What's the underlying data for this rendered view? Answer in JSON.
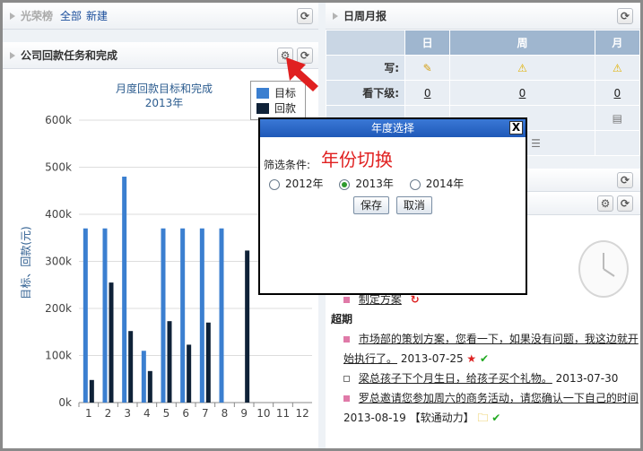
{
  "left_top_panel": {
    "title": "光荣榜",
    "link_all": "全部",
    "link_new": "新建"
  },
  "left_panel": {
    "title": "公司回款任务和完成"
  },
  "chart_data": {
    "type": "bar",
    "title": "月度回款目标和完成",
    "subtitle": "2013年",
    "ylabel": "目标、回款(元)",
    "categories": [
      "1",
      "2",
      "3",
      "4",
      "5",
      "6",
      "7",
      "8",
      "9",
      "10",
      "11",
      "12"
    ],
    "y_ticks": [
      "0k",
      "100k",
      "200k",
      "300k",
      "400k",
      "500k",
      "600k"
    ],
    "ylim": [
      0,
      600000
    ],
    "series": [
      {
        "name": "目标",
        "color": "#3b7fd0",
        "values": [
          370000,
          370000,
          480000,
          110000,
          370000,
          370000,
          370000,
          370000,
          0,
          0,
          0,
          0
        ]
      },
      {
        "name": "回款",
        "color": "#0f2238",
        "values": [
          48000,
          255000,
          152000,
          67000,
          173000,
          123000,
          170000,
          0,
          323000,
          0,
          0,
          0
        ]
      }
    ],
    "legend_placement": "top-right",
    "grid": true
  },
  "right_top_panel": {
    "title": "日周月报",
    "columns": [
      "日",
      "周",
      "月"
    ],
    "rows": [
      {
        "label": "写:",
        "values": [
          "pencil",
          "warn",
          "warn"
        ]
      },
      {
        "label": "看下级:",
        "values": [
          "0",
          "0",
          "0"
        ]
      }
    ]
  },
  "dialog": {
    "title": "年度选择",
    "filter_label": "筛选条件:",
    "options": [
      "2012年",
      "2013年",
      "2014年"
    ],
    "selected": "2013年",
    "save": "保存",
    "cancel": "取消",
    "close": "X"
  },
  "annotation": "年份切换",
  "right_bottom": {
    "plan_link": "制定方案",
    "overdue_label": "超期",
    "items": [
      {
        "text": "市场部的策划方案，您看一下，如果没有问题，我这边就开始执行了。",
        "date": "2013-07-25"
      },
      {
        "text": "梁总孩子下个月生日，给孩子买个礼物。",
        "date": "2013-07-30"
      },
      {
        "text": "罗总邀请您参加周六的商务活动，请您确认一下自己的时间",
        "date": "2013-08-19",
        "tag": "【软通动力】"
      }
    ]
  }
}
